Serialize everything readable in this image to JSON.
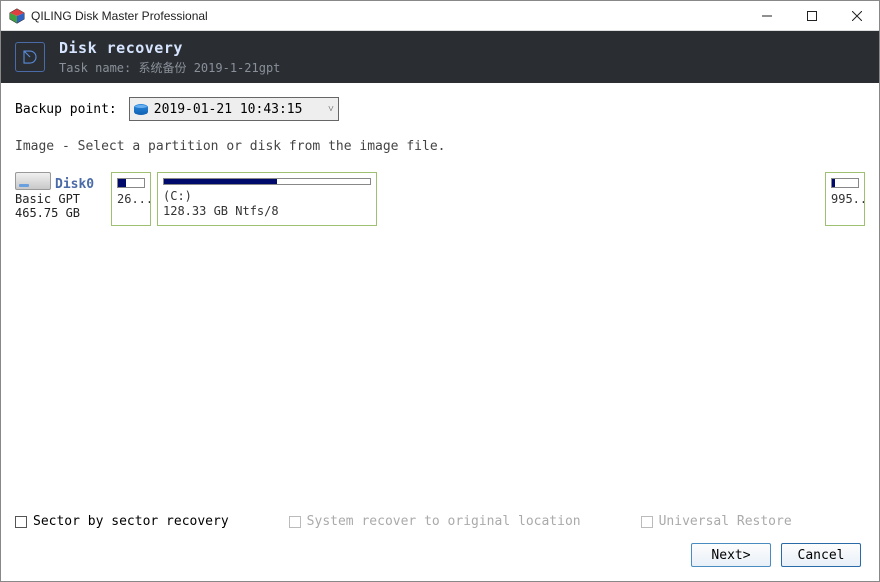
{
  "window": {
    "title": "QILING Disk Master Professional"
  },
  "header": {
    "title": "Disk recovery",
    "task_label": "Task name:",
    "task_name": "系统备份 2019-1-21gpt"
  },
  "backup_point": {
    "label": "Backup point:",
    "selected": "2019-01-21 10:43:15"
  },
  "instruction": "Image - Select a partition or disk from the image file.",
  "disk": {
    "name": "Disk0",
    "type": "Basic GPT",
    "size": "465.75 GB",
    "partitions": [
      {
        "label": "26...",
        "letter": "",
        "detail": "",
        "fill_pct": 30
      },
      {
        "label": "",
        "letter": "(C:)",
        "detail": "128.33 GB Ntfs/8",
        "fill_pct": 55
      },
      {
        "label": "995...",
        "letter": "",
        "detail": "",
        "fill_pct": 12
      }
    ]
  },
  "options": {
    "sector": "Sector by sector recovery",
    "system_recover": "System recover to original location",
    "universal": "Universal Restore"
  },
  "buttons": {
    "next": "Next>",
    "cancel": "Cancel"
  }
}
